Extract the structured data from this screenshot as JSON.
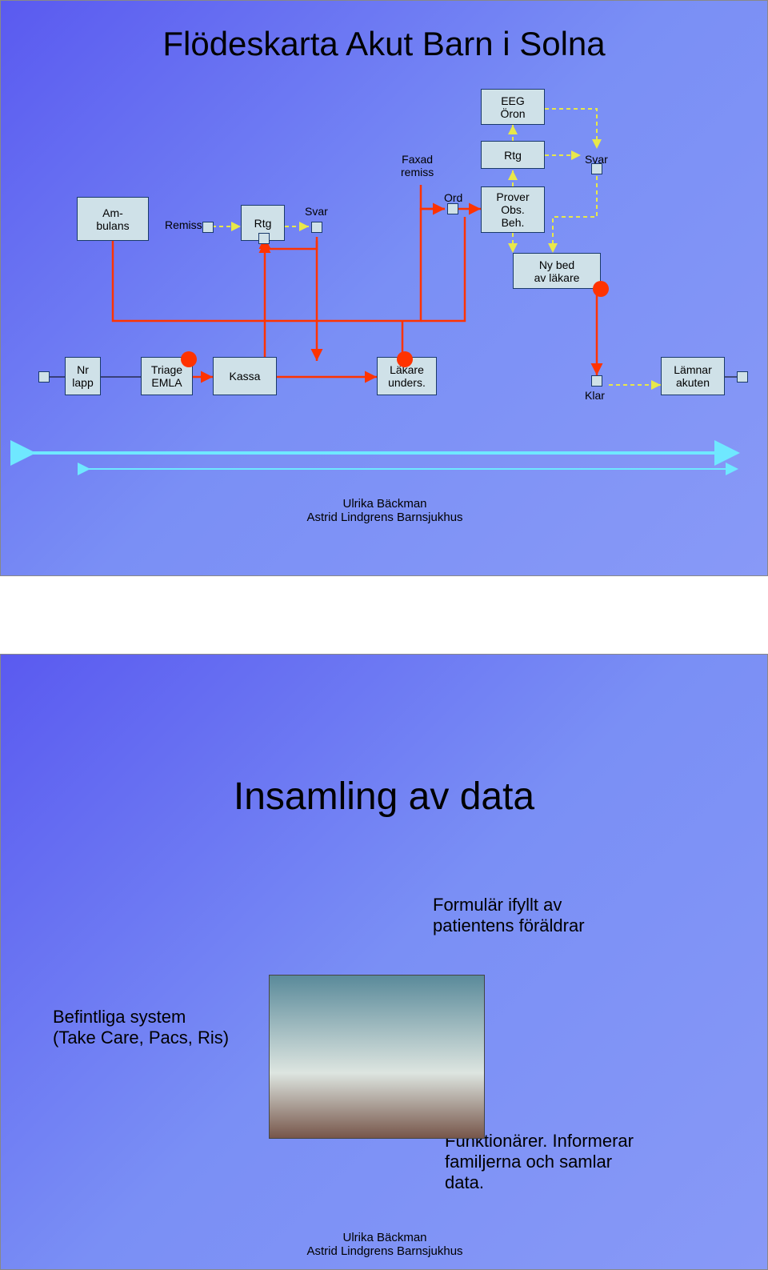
{
  "slide1": {
    "title": "Flödeskarta Akut Barn i Solna",
    "boxes": {
      "ambulans": "Am-\nbulans",
      "remiss": "Remiss",
      "rtg1": "Rtg",
      "svar1": "Svar",
      "faxad": "Faxad\nremiss",
      "eeg": "EEG\nÖron",
      "rtg2": "Rtg",
      "svar2": "Svar",
      "ord": "Ord",
      "prover": "Prover\nObs.\nBeh.",
      "nybed": "Ny bed\nav läkare",
      "nrlapp": "Nr\nlapp",
      "triage": "Triage\nEMLA",
      "kassa": "Kassa",
      "lakare": "Läkare\nunders.",
      "klar": "Klar",
      "lamnar": "Lämnar\nakuten"
    },
    "credit1": "Ulrika Bäckman",
    "credit2": "Astrid Lindgrens Barnsjukhus"
  },
  "slide2": {
    "title": "Insamling av data",
    "text1": "Formulär ifyllt av\npatientens föräldrar",
    "text2": "Befintliga system\n(Take Care, Pacs, Ris)",
    "text3": "Funktionärer. Informerar\nfamiljerna och samlar\ndata.",
    "credit1": "Ulrika Bäckman",
    "credit2": "Astrid Lindgrens Barnsjukhus"
  }
}
